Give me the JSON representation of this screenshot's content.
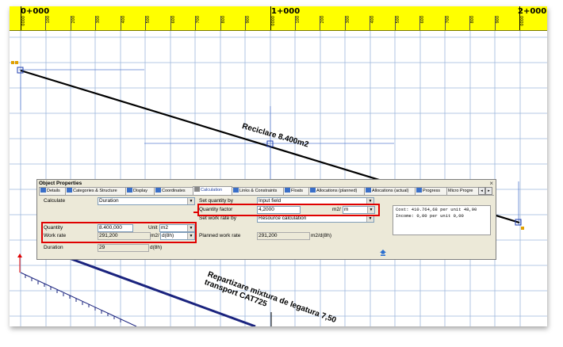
{
  "ruler": {
    "markers": [
      "0+000",
      "1+000",
      "2+000"
    ],
    "ticks": [
      "0000",
      "100",
      "200",
      "300",
      "400",
      "500",
      "600",
      "700",
      "800",
      "900",
      "0000",
      "100",
      "200",
      "300",
      "400",
      "500",
      "600",
      "700",
      "800",
      "900",
      "0000"
    ]
  },
  "annotations": {
    "reciclare": "Reciclare  8.400m2",
    "repartizare_line1": "Repartizare mixtura de legatura 7,50",
    "repartizare_line2": "transport CAT725"
  },
  "dialog": {
    "title": "Object Properties",
    "close": "×",
    "tabs": [
      "Details",
      "Categories & Structure",
      "Display",
      "Coordinates",
      "Calculation",
      "Links & Constraints",
      "Floats",
      "Allocations (planned)",
      "Allocations (actual)",
      "Progress",
      "Micro Progre"
    ],
    "active_tab": "Calculation",
    "calculate_label": "Calculate",
    "calculate_value": "Duration",
    "set_quantity_by_label": "Set quantity by",
    "set_quantity_by_value": "Input field",
    "quantity_factor_label": "Quantity factor",
    "quantity_factor_value": "4,2000",
    "quantity_factor_unit": "m2/",
    "quantity_factor_unit_select": "m",
    "set_work_rate_by_label": "Set work rate by",
    "set_work_rate_by_value": "Resource calculation",
    "quantity_label": "Quantity",
    "quantity_value": "8.400,000",
    "unit_label": "Unit",
    "unit_value": "m2",
    "work_rate_label": "Work rate",
    "work_rate_value": "291,200",
    "work_rate_unit": "m2/",
    "work_rate_unit_select": "d(8h)",
    "planned_work_rate_label": "Planned work rate",
    "planned_work_rate_value": "291,200",
    "planned_work_rate_unit": "m2/d(8h)",
    "duration_label": "Duration",
    "duration_value": "29",
    "duration_unit": "d(8h)",
    "cost_line1": "Cost: 410.764,68 per unit 48,90",
    "cost_line2": "Income: 0,00 per unit 0,00"
  },
  "colors": {
    "ruler_bg": "#ffff00",
    "grid": "#7a9fd0",
    "highlight": "#e00000",
    "task_line_2": "#1a237e"
  }
}
